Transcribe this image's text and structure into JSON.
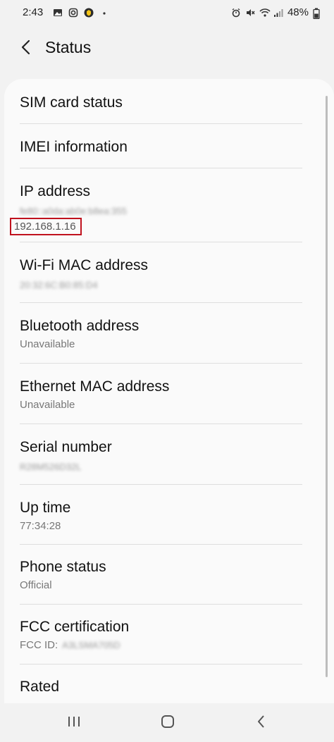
{
  "status_bar": {
    "time": "2:43",
    "battery": "48%",
    "left_icons": [
      "gallery-icon",
      "instagram-icon",
      "norton-icon",
      "dot-icon"
    ],
    "right_icons": [
      "alarm-icon",
      "mute-icon",
      "wifi-icon",
      "signal-icon",
      "battery-icon"
    ]
  },
  "header": {
    "title": "Status",
    "back_icon": "chevron-left-icon"
  },
  "items": [
    {
      "title": "SIM card status"
    },
    {
      "title": "IMEI information"
    },
    {
      "title": "IP address",
      "blurred_line": "fe80::a0da:ab0e:b8ea:355",
      "highlight_value": "192.168.1.16"
    },
    {
      "title": "Wi-Fi MAC address",
      "blurred_line": "20:32:6C:B0:85:D4"
    },
    {
      "title": "Bluetooth address",
      "subtitle": "Unavailable"
    },
    {
      "title": "Ethernet MAC address",
      "subtitle": "Unavailable"
    },
    {
      "title": "Serial number",
      "blurred_line": "R28M526D32L"
    },
    {
      "title": "Up time",
      "subtitle": "77:34:28"
    },
    {
      "title": "Phone status",
      "subtitle": "Official"
    },
    {
      "title": "FCC certification",
      "fcc_label": "FCC ID:",
      "blurred_line": "A3LSMA705D"
    },
    {
      "title": "Rated"
    }
  ],
  "highlight_color": "#c0121e",
  "nav_bar": {
    "buttons": [
      "recent-apps-icon",
      "home-icon",
      "back-icon"
    ]
  }
}
